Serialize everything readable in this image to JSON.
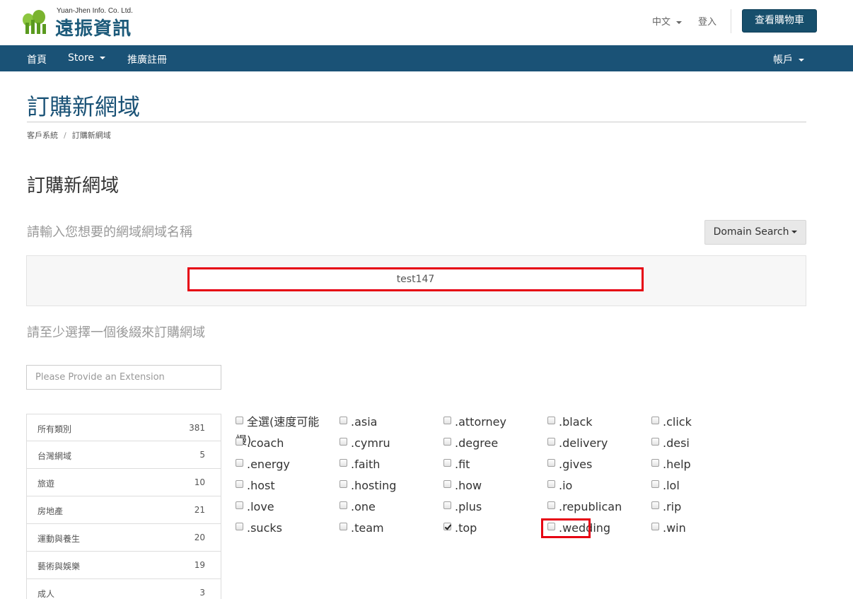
{
  "header": {
    "logo_small": "Yuan-Jhen Info. Co. Ltd.",
    "logo_big": "遠振資訊",
    "language": "中文",
    "login": "登入",
    "cart_button": "查看購物車"
  },
  "nav": {
    "home": "首頁",
    "store": "Store",
    "affiliate": "推廣註冊",
    "account": "帳戶"
  },
  "page": {
    "title": "訂購新網域",
    "breadcrumb": [
      "客戶系統",
      "訂購新網域"
    ],
    "section_title": "訂購新網域",
    "hint_domain": "請輸入您想要的網域網域名稱",
    "domain_search_button": "Domain Search",
    "domain_value": "test147",
    "hint_extension": "請至少選擇一個後綴來訂購網域",
    "extension_placeholder": "Please Provide an Extension"
  },
  "categories": [
    {
      "name": "所有類別",
      "count": "381"
    },
    {
      "name": "台灣網域",
      "count": "5"
    },
    {
      "name": "旅遊",
      "count": "10"
    },
    {
      "name": "房地產",
      "count": "21"
    },
    {
      "name": "運動與養生",
      "count": "20"
    },
    {
      "name": "藝術與娛樂",
      "count": "19"
    },
    {
      "name": "成人",
      "count": "3"
    }
  ],
  "tlds": {
    "select_all_1": "全選(速度可能",
    "select_all_2": "慢)",
    "items": [
      ".asia",
      ".attorney",
      ".black",
      ".click",
      ".coach",
      ".cymru",
      ".degree",
      ".delivery",
      ".desi",
      ".energy",
      ".faith",
      ".fit",
      ".gives",
      ".help",
      ".host",
      ".hosting",
      ".how",
      ".io",
      ".lol",
      ".love",
      ".one",
      ".plus",
      ".republican",
      ".rip",
      ".sucks",
      ".team",
      ".top",
      ".wedding",
      ".win"
    ],
    "checked": ".top"
  },
  "colors": {
    "nav_bg": "#1a5276",
    "title_color": "#1a5276",
    "highlight": "#e60012"
  }
}
